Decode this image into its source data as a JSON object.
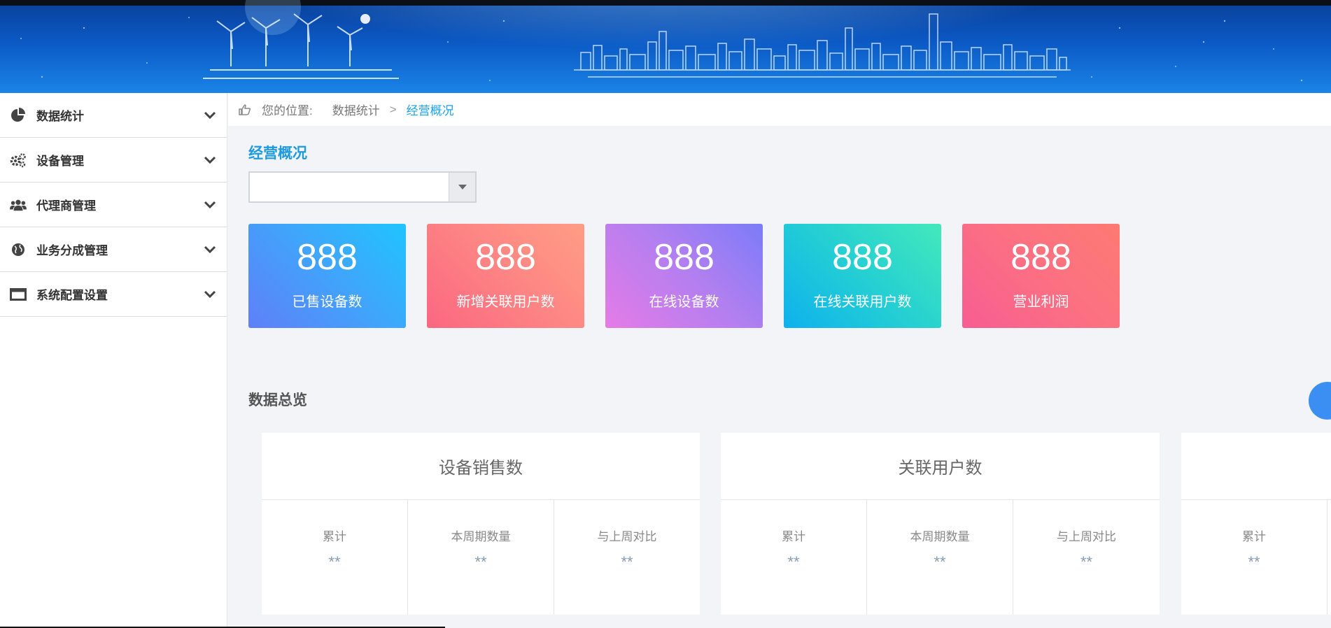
{
  "sidebar": {
    "items": [
      {
        "label": "数据统计",
        "icon": "pie-chart-icon"
      },
      {
        "label": "设备管理",
        "icon": "gears-icon"
      },
      {
        "label": "代理商管理",
        "icon": "users-icon"
      },
      {
        "label": "业务分成管理",
        "icon": "globe-icon"
      },
      {
        "label": "系统配置设置",
        "icon": "window-icon"
      }
    ]
  },
  "breadcrumb": {
    "prefix": "您的位置:",
    "level1": "数据统计",
    "separator": ">",
    "current": "经营概况"
  },
  "main": {
    "title": "经营概况",
    "select": {
      "value": ""
    },
    "cards": [
      {
        "value": "888",
        "label": "已售设备数"
      },
      {
        "value": "888",
        "label": "新增关联用户数"
      },
      {
        "value": "888",
        "label": "在线设备数"
      },
      {
        "value": "888",
        "label": "在线关联用户数"
      },
      {
        "value": "888",
        "label": "营业利润"
      }
    ],
    "overview_title": "数据总览",
    "panels": [
      {
        "title": "设备销售数",
        "cols": [
          {
            "label": "累计",
            "value": "**"
          },
          {
            "label": "本周期数量",
            "value": "**"
          },
          {
            "label": "与上周对比",
            "value": "**"
          }
        ]
      },
      {
        "title": "关联用户数",
        "cols": [
          {
            "label": "累计",
            "value": "**"
          },
          {
            "label": "本周期数量",
            "value": "**"
          },
          {
            "label": "与上周对比",
            "value": "**"
          }
        ]
      },
      {
        "title": "",
        "cols": [
          {
            "label": "累计",
            "value": "**"
          }
        ]
      }
    ]
  },
  "colors": {
    "accent": "#1aa3e8",
    "banner": "#0b59c4"
  }
}
